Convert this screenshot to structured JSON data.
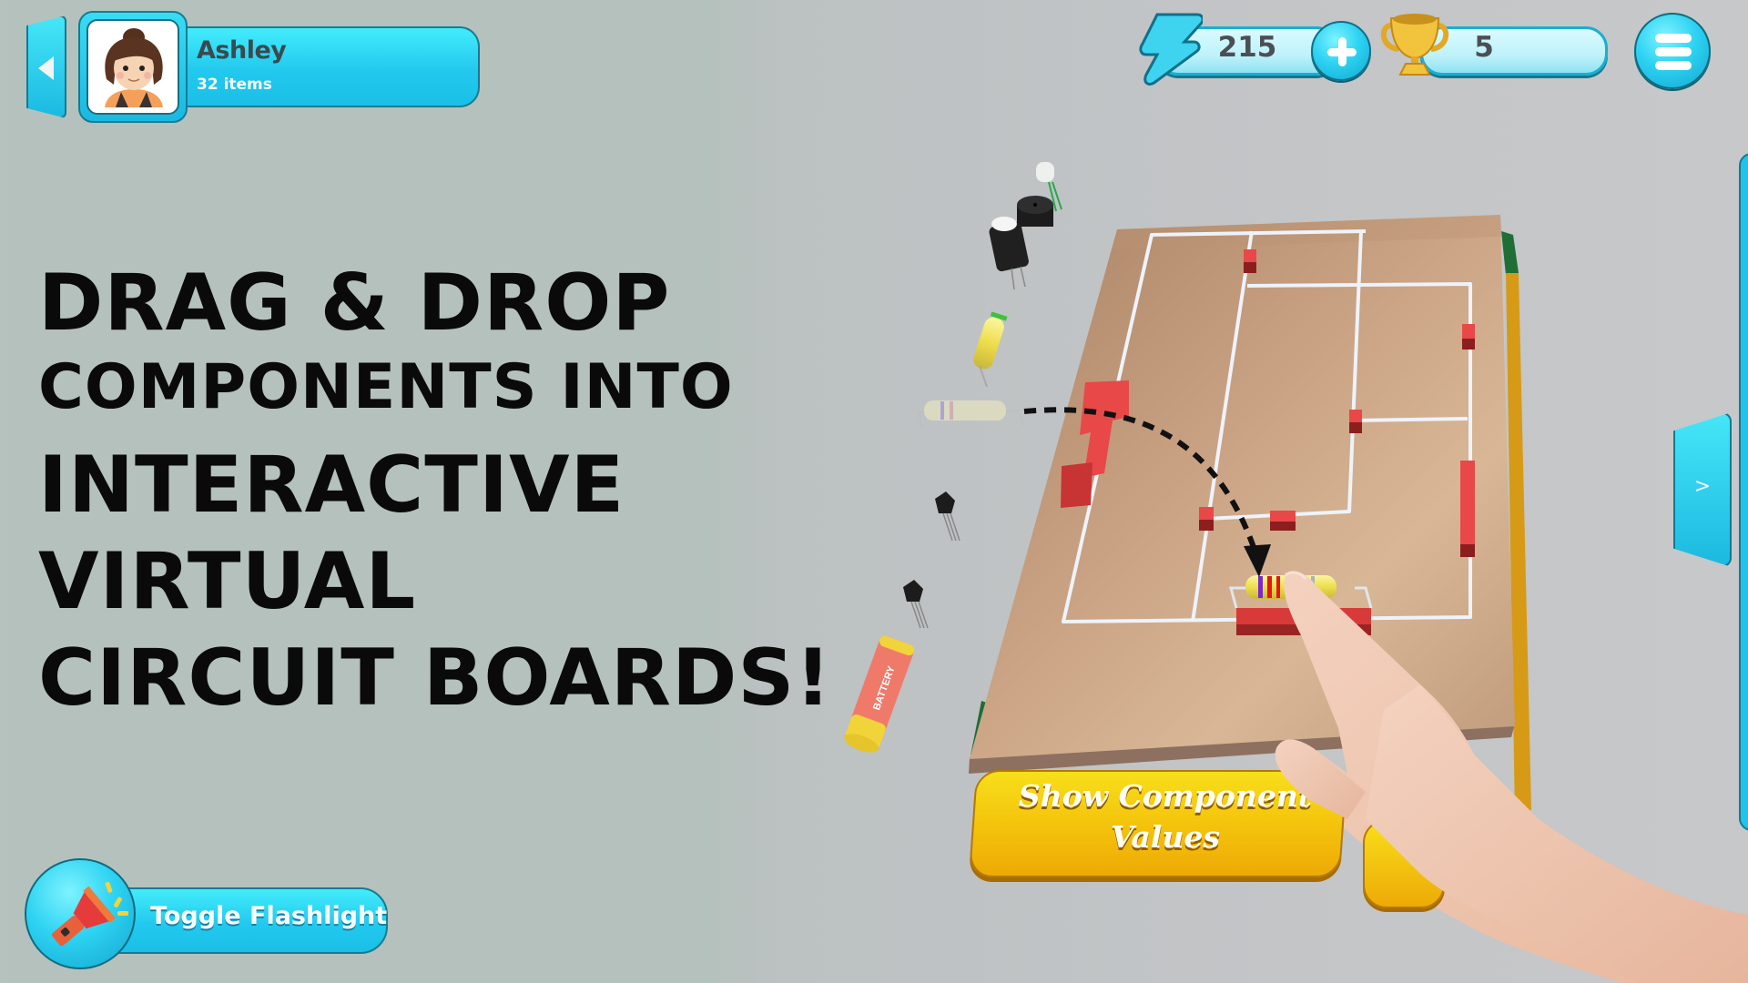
{
  "profile": {
    "name": "Ashley",
    "items": "32 items",
    "back_icon": "triangle-left-icon",
    "avatar": "girl-avatar"
  },
  "hud": {
    "energy": {
      "icon": "lightning-icon",
      "value": "215",
      "add_icon": "plus-icon"
    },
    "trophies": {
      "icon": "trophy-icon",
      "value": "5"
    },
    "menu_icon": "hamburger-menu-icon"
  },
  "headline": {
    "line1": "DRAG & DROP",
    "line2": "COMPONENTS INTO",
    "line3": "INTERACTIVE",
    "line4": "VIRTUAL",
    "line5": "CIRCUIT BOARDS!"
  },
  "flashlight": {
    "icon": "flashlight-icon",
    "label": "Toggle Flashlight"
  },
  "side_tab": {
    "label": ">"
  },
  "values_button": {
    "line1": "Show Component",
    "line2": "Values"
  },
  "scene": {
    "battery_label": "BATTERY",
    "components": [
      "led",
      "buzzer",
      "capacitor",
      "resistor",
      "resistor-ghost",
      "transistor",
      "transistor",
      "battery"
    ],
    "dragged_component": "resistor",
    "colors": {
      "accent_cyan": "#22c9ee",
      "button_yellow": "#f4c40c",
      "wire": "#e8f0fa",
      "connector_red": "#e84848",
      "wood": "#b8906a"
    }
  }
}
